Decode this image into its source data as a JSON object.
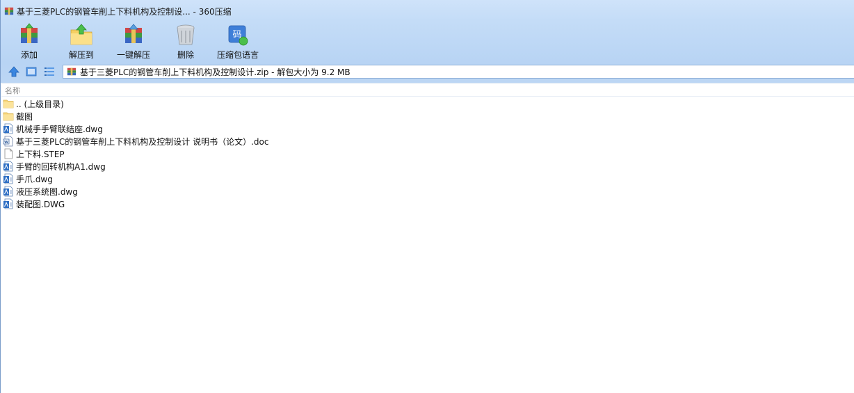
{
  "window": {
    "title": "基于三菱PLC的钢管车削上下料机构及控制设... - 360压缩"
  },
  "toolbar": {
    "add_label": "添加",
    "extract_to_label": "解压到",
    "one_click_extract_label": "一键解压",
    "delete_label": "删除",
    "language_label": "压缩包语言"
  },
  "address": {
    "text": "基于三菱PLC的钢管车削上下料机构及控制设计.zip - 解包大小为 9.2 MB"
  },
  "list_header": {
    "name_col": "名称"
  },
  "files": [
    {
      "name": ".. (上级目录)",
      "icon": "folder-icon"
    },
    {
      "name": "截图",
      "icon": "folder-icon"
    },
    {
      "name": "机械手手臂联结座.dwg",
      "icon": "dwg-file-icon"
    },
    {
      "name": "基于三菱PLC的钢管车削上下料机构及控制设计 说明书（论文）.doc",
      "icon": "doc-file-icon"
    },
    {
      "name": "上下料.STEP",
      "icon": "blank-file-icon"
    },
    {
      "name": "手臂的回转机构A1.dwg",
      "icon": "dwg-file-icon"
    },
    {
      "name": "手爪.dwg",
      "icon": "dwg-file-icon"
    },
    {
      "name": "液压系统图.dwg",
      "icon": "dwg-file-icon"
    },
    {
      "name": "装配图.DWG",
      "icon": "dwg-file-icon"
    }
  ]
}
